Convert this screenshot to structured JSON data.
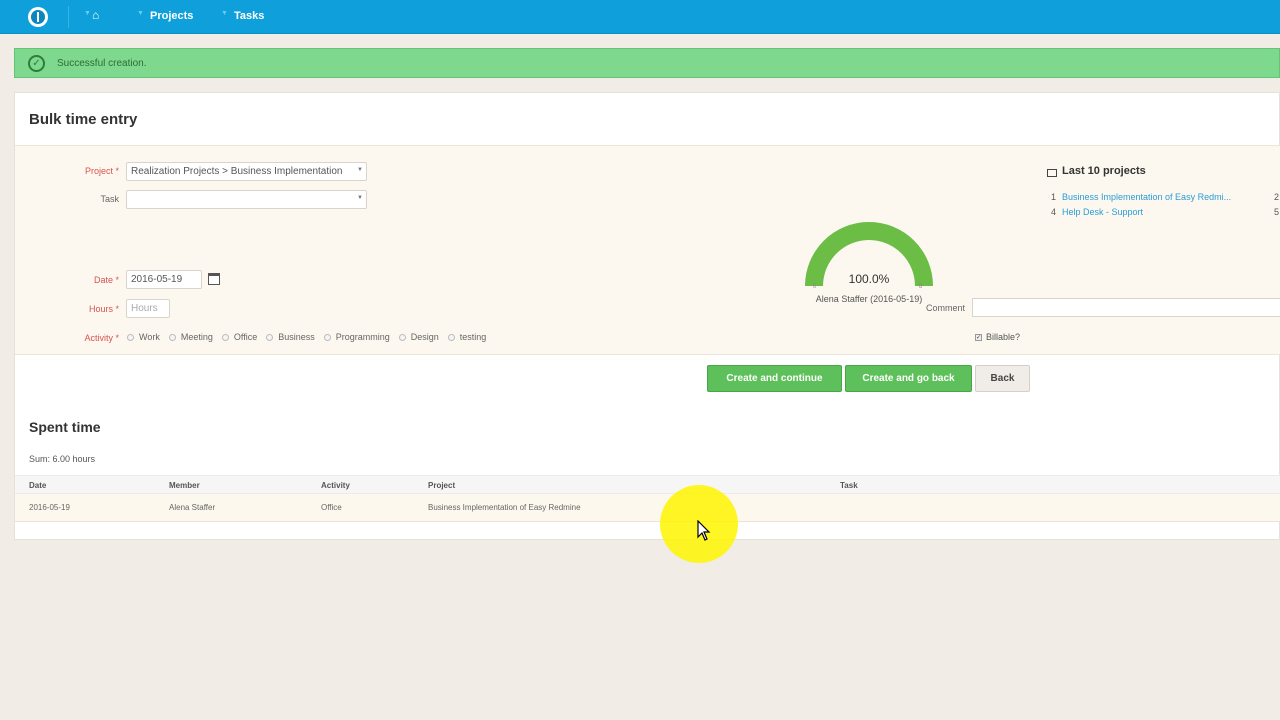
{
  "topbar": {
    "logo_icon": "power-icon",
    "home_icon": "home-icon",
    "nav": [
      {
        "label": "Projects"
      },
      {
        "label": "Tasks"
      }
    ]
  },
  "flash": {
    "icon": "check-circle-icon",
    "message": "Successful creation."
  },
  "form": {
    "title": "Bulk time entry",
    "project_label": "Project *",
    "project_value": "Realization Projects > Business Implementation",
    "task_label": "Task",
    "task_value": "",
    "date_label": "Date *",
    "date_value": "2016-05-19",
    "hours_label": "Hours *",
    "hours_placeholder": "Hours",
    "activity_label": "Activity *",
    "activities": [
      "Work",
      "Meeting",
      "Office",
      "Business",
      "Programming",
      "Design",
      "testing"
    ],
    "comment_label": "Comment",
    "comment_value": "",
    "billable_label": "Billable?",
    "billable_checked": true
  },
  "gauge": {
    "value_text": "100.0%",
    "fraction": 1.0,
    "min": "0",
    "max": "8",
    "caption": "Alena Staffer (2016-05-19)",
    "color": "#6cbd45"
  },
  "last_projects": {
    "title": "Last 10 projects",
    "items": [
      {
        "num": "1",
        "name": "Business Implementation of Easy Redmi...",
        "count": "2"
      },
      {
        "num": "4",
        "name": "Help Desk - Support",
        "count": "5"
      }
    ]
  },
  "buttons": {
    "create_continue": "Create and continue",
    "create_back": "Create and go back",
    "back": "Back"
  },
  "spent": {
    "title": "Spent time",
    "sum": "Sum: 6.00 hours",
    "columns": [
      "Date",
      "Member",
      "Activity",
      "Project",
      "Task"
    ],
    "rows": [
      {
        "date": "2016-05-19",
        "member": "Alena Staffer",
        "activity": "Office",
        "project": "Business Implementation of Easy Redmine",
        "task": ""
      }
    ]
  },
  "colors": {
    "topbar": "#0fa0db",
    "flash": "#7ed88e",
    "button_green": "#5dc05a",
    "link": "#2a9cd6"
  }
}
